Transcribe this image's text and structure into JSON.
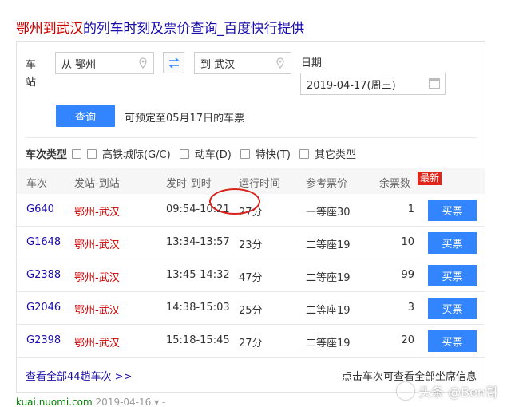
{
  "title": {
    "part1": "鄂州到武汉",
    "part2": "的列车时刻及票价查询_百度快行提供"
  },
  "search": {
    "station_label": "车站",
    "from_value": "从 鄂州",
    "to_value": "到 武汉",
    "date_label": "日期",
    "date_value": "2019-04-17(周三)",
    "query_button": "查询",
    "presale_note": "可预定至05月17日的车票"
  },
  "filters": {
    "label": "车次类型",
    "options": [
      "高铁城际(G/C)",
      "动车(D)",
      "特快(T)",
      "其它类型"
    ]
  },
  "table": {
    "headers": [
      "车次",
      "发站-到站",
      "发时-到时",
      "运行时间",
      "参考票价",
      "余票数"
    ],
    "new_badge": "最新",
    "buy_label": "买票",
    "rows": [
      {
        "train": "G640",
        "route": "鄂州-武汉",
        "time": "09:54-10:21",
        "duration": "27分",
        "price": "一等座30",
        "left": "1"
      },
      {
        "train": "G1648",
        "route": "鄂州-武汉",
        "time": "13:34-13:57",
        "duration": "23分",
        "price": "二等座19",
        "left": "10"
      },
      {
        "train": "G2388",
        "route": "鄂州-武汉",
        "time": "13:45-14:32",
        "duration": "47分",
        "price": "二等座19",
        "left": "99"
      },
      {
        "train": "G2046",
        "route": "鄂州-武汉",
        "time": "14:38-15:03",
        "duration": "25分",
        "price": "二等座19",
        "left": "3"
      },
      {
        "train": "G2398",
        "route": "鄂州-武汉",
        "time": "15:18-15:45",
        "duration": "27分",
        "price": "二等座19",
        "left": "20"
      }
    ]
  },
  "footer": {
    "view_all": "查看全部44趟车次 >>",
    "hint": "点击车次可查看全部坐席信息"
  },
  "source": {
    "url": "kuai.nuomi.com",
    "date": "2019-04-16",
    "suffix": "▾ - "
  },
  "watermark": {
    "text": "头条 @Ben哥"
  },
  "colors": {
    "accent": "#3385ff",
    "link": "#1a0dab",
    "route": "#cc0000",
    "annotation": "#d9221b"
  }
}
